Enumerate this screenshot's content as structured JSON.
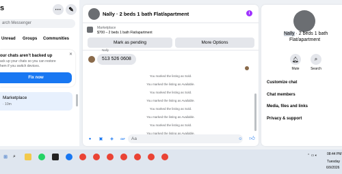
{
  "left": {
    "title_fragment": "s",
    "search_placeholder": "arch Messenger",
    "tabs": [
      "Unread",
      "Groups",
      "Communities"
    ],
    "backup_title": "our chats aren’t backed up",
    "backup_line1": "ack up your chats so you can restore",
    "backup_line2": "hem if you switch devices.",
    "fix_button": "Fix now",
    "conversation_name": "Marketplace",
    "conversation_time": "· 10m"
  },
  "chat": {
    "header_title": "Nally · 2 beds 1 bath Flat/apartment",
    "marketplace_label": "Marketplace",
    "listing": "$700 – 2 beds 1 bath Flat/apartment",
    "mark_pending": "Mark as pending",
    "more_options": "More Options",
    "sender_name": "Nally",
    "message": "513 526 0608",
    "system_messages": [
      "You marked the listing as Sold.",
      "You marked the listing as Available.",
      "You marked the listing as Sold.",
      "You marked the listing as Available.",
      "You marked the listing as Sold.",
      "You marked the listing as Available.",
      "You marked the listing as Sold.",
      "You marked the listing as Available."
    ],
    "composer_placeholder": "Aa"
  },
  "right": {
    "name_highlight": "Nally",
    "title_rest": " · 2 beds 1 bath",
    "title_line2": "Flat/apartment",
    "mute_label": "Mute",
    "search_label": "Search",
    "sections": [
      "Customize chat",
      "Chat members",
      "Media, files and links",
      "Privacy & support"
    ]
  },
  "taskbar": {
    "time": "08:44 PM",
    "day": "Tuesday",
    "date": "6/9/2026"
  },
  "colors": {
    "accent": "#1877f2",
    "header_dot": "#a033ff"
  }
}
